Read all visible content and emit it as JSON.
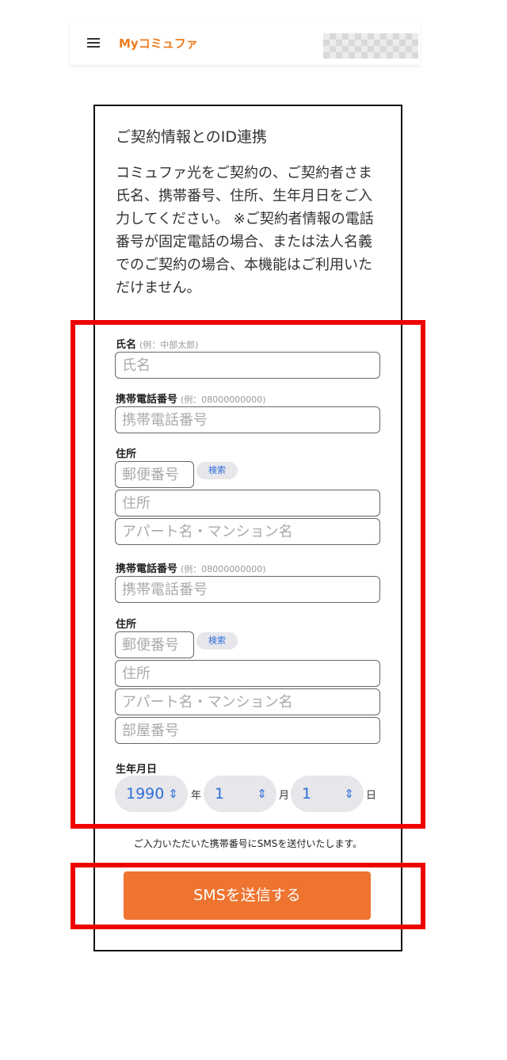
{
  "header": {
    "logo_text": "Myコミュファ",
    "profile_placeholder": "mosaic"
  },
  "card": {
    "title": "ご契約情報とのID連携",
    "intro": "コミュファ光をご契約の、ご契約者さま氏名、携帯番号、住所、生年月日をご入力してください。\n※ご契約者情報の電話番号が固定電話の場合、または法人名義でのご契約の場合、本機能はご利用いただけません。"
  },
  "form": {
    "name": {
      "label": "氏名",
      "hint": "(例：中部太郎)",
      "placeholder": "氏名"
    },
    "phone1": {
      "label": "携帯電話番号",
      "hint": "(例：08000000000)",
      "placeholder": "携帯電話番号"
    },
    "address1": {
      "label": "住所",
      "zip_placeholder": "郵便番号",
      "search_label": "検索",
      "address_placeholder": "住所",
      "building_placeholder": "アパート名・マンション名"
    },
    "phone2": {
      "label": "携帯電話番号",
      "hint": "(例：08000000000)",
      "placeholder": "携帯電話番号"
    },
    "address2": {
      "label": "住所",
      "zip_placeholder": "郵便番号",
      "search_label": "検索",
      "address_placeholder": "住所",
      "building_placeholder": "アパート名・マンション名",
      "room_placeholder": "部屋番号"
    },
    "birthdate": {
      "label": "生年月日",
      "year": "1990",
      "year_unit": "年",
      "month": "1",
      "month_unit": "月",
      "day": "1",
      "day_unit": "日"
    }
  },
  "notice": "ご入力いただいた携帯番号にSMSを送付いたします。",
  "submit_label": "SMSを送信する",
  "colors": {
    "accent": "#ee7430",
    "highlight": "#ee0000",
    "link": "#2f6fd8"
  }
}
